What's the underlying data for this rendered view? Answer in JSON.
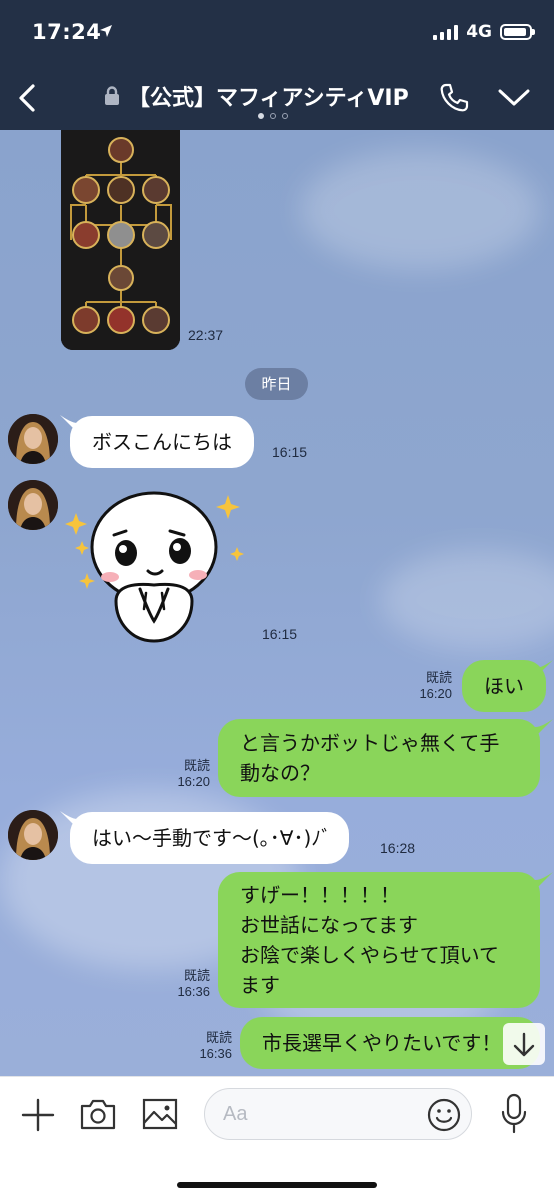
{
  "status": {
    "time": "17:24",
    "network": "4G"
  },
  "header": {
    "title": "【公式】マフィアシティVIP"
  },
  "chat": {
    "image_time": "22:37",
    "date_divider": "昨日",
    "messages": [
      {
        "id": "m1",
        "side": "in",
        "text": "ボスこんにちは",
        "time": "16:15"
      },
      {
        "id": "m2",
        "side": "in",
        "sticker": "cute-character-sticker",
        "time": "16:15"
      },
      {
        "id": "m3",
        "side": "out",
        "text": "ほい",
        "read": "既読",
        "time": "16:20"
      },
      {
        "id": "m4",
        "side": "out",
        "lines": [
          "と言うかボットじゃ無くて手",
          "動なの？"
        ],
        "read": "既読",
        "time": "16:20"
      },
      {
        "id": "m5",
        "side": "in",
        "text": "はい〜手動です〜(｡･∀･)ﾉﾞ",
        "time": "16:28"
      },
      {
        "id": "m6",
        "side": "out",
        "lines": [
          "すげー！！！！！",
          "お世話になってます",
          "お陰で楽しくやらせて頂いて",
          "ます"
        ],
        "read": "既読",
        "time": "16:36"
      },
      {
        "id": "m7",
        "side": "out",
        "text": "市長選早くやりたいです！",
        "read": "既読",
        "time": "16:36"
      }
    ]
  },
  "input": {
    "placeholder": "Aa"
  },
  "colors": {
    "header_bg": "#233046",
    "chat_bg": "#8ea6cf",
    "outgoing_bubble": "#8ad55a",
    "incoming_bubble": "#ffffff",
    "date_pill": "#6c7fa3"
  },
  "icons": {
    "back": "chevron-left-icon",
    "lock": "lock-icon",
    "call": "phone-icon",
    "menu": "chevron-down-icon",
    "plus": "plus-icon",
    "camera": "camera-icon",
    "gallery": "image-icon",
    "emoji": "emoji-icon",
    "mic": "microphone-icon",
    "scroll": "arrow-down-icon"
  }
}
